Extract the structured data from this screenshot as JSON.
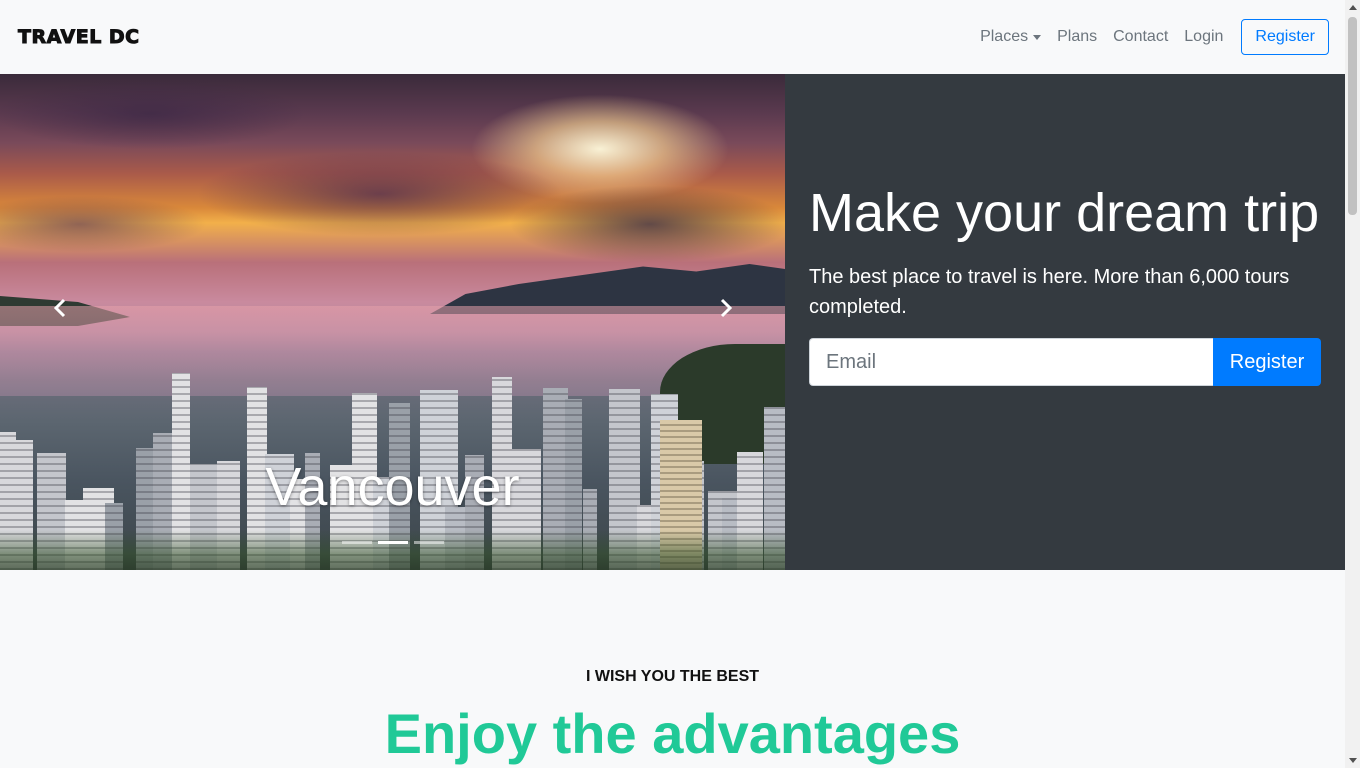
{
  "navbar": {
    "brand": "TRAVEL DC",
    "links": {
      "places": "Places",
      "plans": "Plans",
      "contact": "Contact",
      "login": "Login"
    },
    "register_label": "Register"
  },
  "hero": {
    "carousel": {
      "caption": "Vancouver",
      "prev_icon": "chevron-left-icon",
      "next_icon": "chevron-right-icon",
      "slide_count": 3,
      "active_slide": 2
    },
    "headline": "Make your dream trip",
    "lead": "The best place to travel is here. More than 6,000 tours completed.",
    "form": {
      "email_placeholder": "Email",
      "submit_label": "Register"
    }
  },
  "section": {
    "eyebrow": "I WISH YOU THE BEST",
    "title": "Enjoy the advantages"
  },
  "colors": {
    "primary": "#007bff",
    "dark_panel": "#343a40",
    "accent_teal": "#20c997",
    "muted": "#6c757d"
  }
}
